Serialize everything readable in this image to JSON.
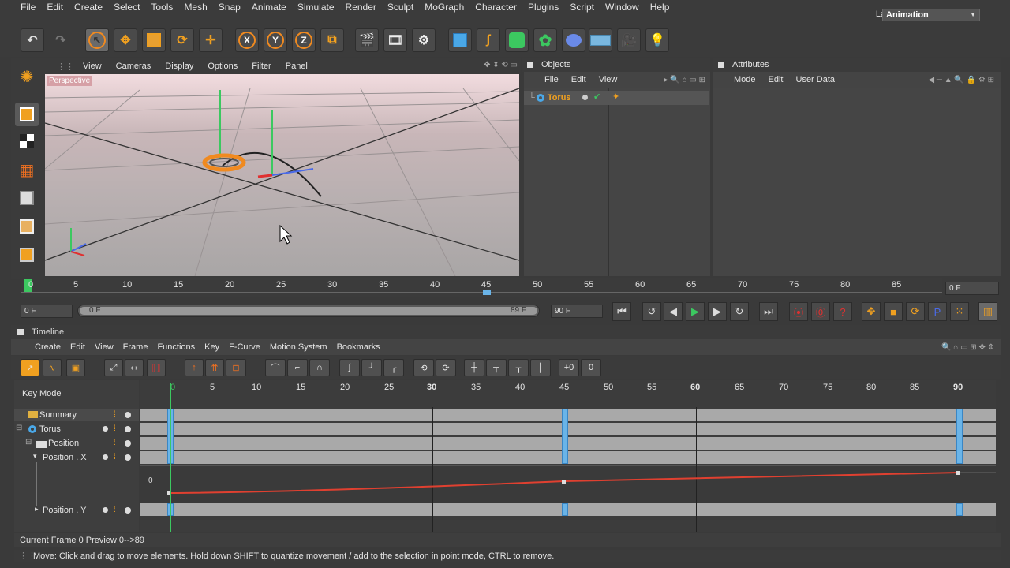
{
  "menubar": {
    "items": [
      "File",
      "Edit",
      "Create",
      "Select",
      "Tools",
      "Mesh",
      "Snap",
      "Animate",
      "Simulate",
      "Render",
      "Sculpt",
      "MoGraph",
      "Character",
      "Plugins",
      "Script",
      "Window",
      "Help"
    ],
    "layout_label": "Layout:",
    "layout_value": "Animation"
  },
  "toolbar": {
    "axis_x": "X",
    "axis_y": "Y",
    "axis_z": "Z"
  },
  "viewport": {
    "menu": [
      "View",
      "Cameras",
      "Display",
      "Options",
      "Filter",
      "Panel"
    ],
    "label": "Perspective"
  },
  "objects": {
    "title": "Objects",
    "menu": [
      "File",
      "Edit",
      "View"
    ],
    "item": "Torus"
  },
  "attributes": {
    "title": "Attributes",
    "menu": [
      "Mode",
      "Edit",
      "User Data"
    ]
  },
  "ruler": {
    "ticks": [
      "0",
      "5",
      "10",
      "15",
      "20",
      "25",
      "30",
      "35",
      "40",
      "45",
      "50",
      "55",
      "60",
      "65",
      "70",
      "75",
      "80",
      "85"
    ],
    "current": "0 F"
  },
  "playback": {
    "start": "0 F",
    "slider_start": "0 F",
    "slider_end": "89 F",
    "end": "90 F"
  },
  "timeline": {
    "title": "Timeline",
    "menu": [
      "Create",
      "Edit",
      "View",
      "Frame",
      "Functions",
      "Key",
      "F-Curve",
      "Motion System",
      "Bookmarks"
    ],
    "key_mode": "Key Mode",
    "ticks": [
      "0",
      "5",
      "10",
      "15",
      "20",
      "25",
      "30",
      "35",
      "40",
      "45",
      "50",
      "55",
      "60",
      "65",
      "70",
      "75",
      "80",
      "85",
      "90"
    ],
    "tree": {
      "summary": "Summary",
      "torus": "Torus",
      "position": "Position",
      "position_x": "Position . X",
      "position_y": "Position . Y"
    },
    "curve_zero": "0",
    "current_frame": "Current Frame  0  Preview  0-->89"
  },
  "status": "Move: Click and drag to move elements. Hold down SHIFT to quantize movement / add to the selection in point mode, CTRL to remove.",
  "colors": {
    "accent_orange": "#f08a20",
    "key_blue": "#6ab4e8",
    "curve_red": "#e04030",
    "play_green": "#3cc860"
  }
}
